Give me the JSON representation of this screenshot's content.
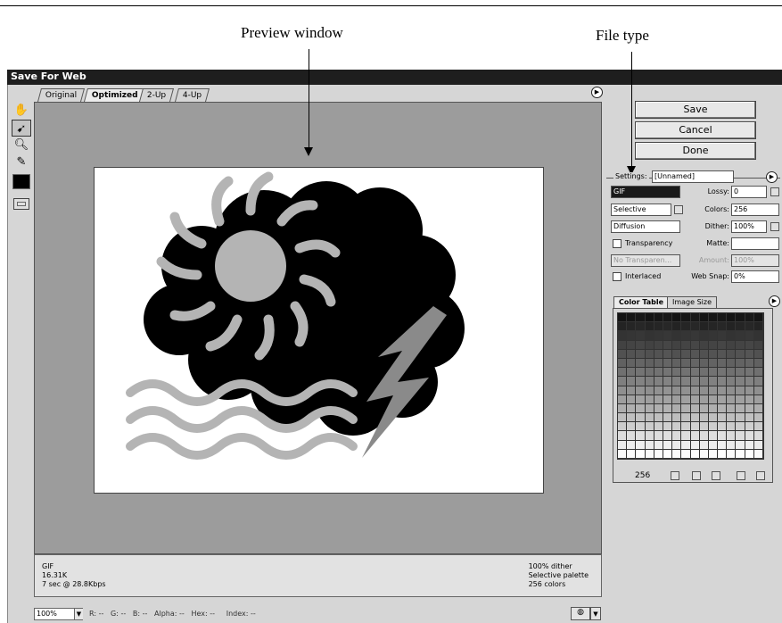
{
  "annotations": {
    "preview_label": "Preview window",
    "filetype_label": "File type"
  },
  "window": {
    "title": "Save For Web"
  },
  "tabs": [
    {
      "label": "Original"
    },
    {
      "label": "Optimized"
    },
    {
      "label": "2-Up"
    },
    {
      "label": "4-Up"
    }
  ],
  "tools": [
    "hand-tool-icon",
    "slice-select-tool-icon",
    "zoom-tool-icon",
    "eyedropper-tool-icon",
    "eyedropper-color-swatch",
    "toggle-slices-icon"
  ],
  "info": {
    "format": "GIF",
    "size": "16.31K",
    "download_time": "7 sec @ 28.8Kbps",
    "dither": "100% dither",
    "palette": "Selective palette",
    "colors": "256 colors"
  },
  "status": {
    "zoom": "100%",
    "r_label": "R:",
    "r_value": "--",
    "g_label": "G:",
    "g_value": "--",
    "b_label": "B:",
    "b_value": "--",
    "alpha_label": "Alpha:",
    "alpha_value": "--",
    "hex_label": "Hex:",
    "hex_value": "--",
    "index_label": "Index:",
    "index_value": "--"
  },
  "buttons": {
    "save": "Save",
    "cancel": "Cancel",
    "done": "Done"
  },
  "settings": {
    "label": "Settings:",
    "preset": "[Unnamed]",
    "file_format": "GIF",
    "palette": "Selective",
    "dither_algo": "Diffusion",
    "transparency_label": "Transparency",
    "transparency_dither": "No Transparen...",
    "interlaced_label": "Interlaced",
    "lossy_label": "Lossy:",
    "lossy_value": "0",
    "colors_label": "Colors:",
    "colors_value": "256",
    "dither_label": "Dither:",
    "dither_value": "100%",
    "matte_label": "Matte:",
    "matte_value": "",
    "amount_label": "Amount:",
    "amount_value": "100%",
    "websnap_label": "Web Snap:",
    "websnap_value": "0%"
  },
  "color_table": {
    "tab_color_table": "Color Table",
    "tab_image_size": "Image Size",
    "count": "256"
  },
  "colors": {
    "titlebar": "#1e1e1e",
    "panel": "#d6d6d6",
    "canvas_backdrop": "#9c9c9c",
    "artwork_black": "#000000",
    "artwork_gray": "#b4b4b4",
    "bolt_gray": "#8a8a8a"
  }
}
